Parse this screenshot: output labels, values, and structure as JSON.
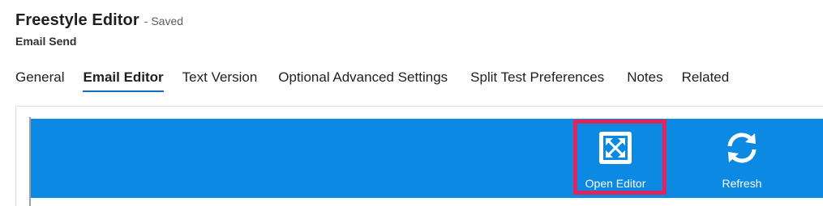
{
  "header": {
    "title": "Freestyle Editor",
    "status": "- Saved",
    "subtitle": "Email Send"
  },
  "tabs": [
    {
      "label": "General",
      "active": false
    },
    {
      "label": "Email Editor",
      "active": true
    },
    {
      "label": "Text Version",
      "active": false
    },
    {
      "label": "Optional Advanced Settings",
      "active": false
    },
    {
      "label": "Split Test Preferences",
      "active": false
    },
    {
      "label": "Notes",
      "active": false
    },
    {
      "label": "Related",
      "active": false
    }
  ],
  "toolbar": {
    "open_editor": {
      "label": "Open Editor",
      "icon": "expand-icon"
    },
    "refresh": {
      "label": "Refresh",
      "icon": "refresh-icon"
    }
  },
  "colors": {
    "toolbar_bg": "#0b89e3",
    "highlight": "#e0245e",
    "tab_underline": "#0f6cbd"
  }
}
